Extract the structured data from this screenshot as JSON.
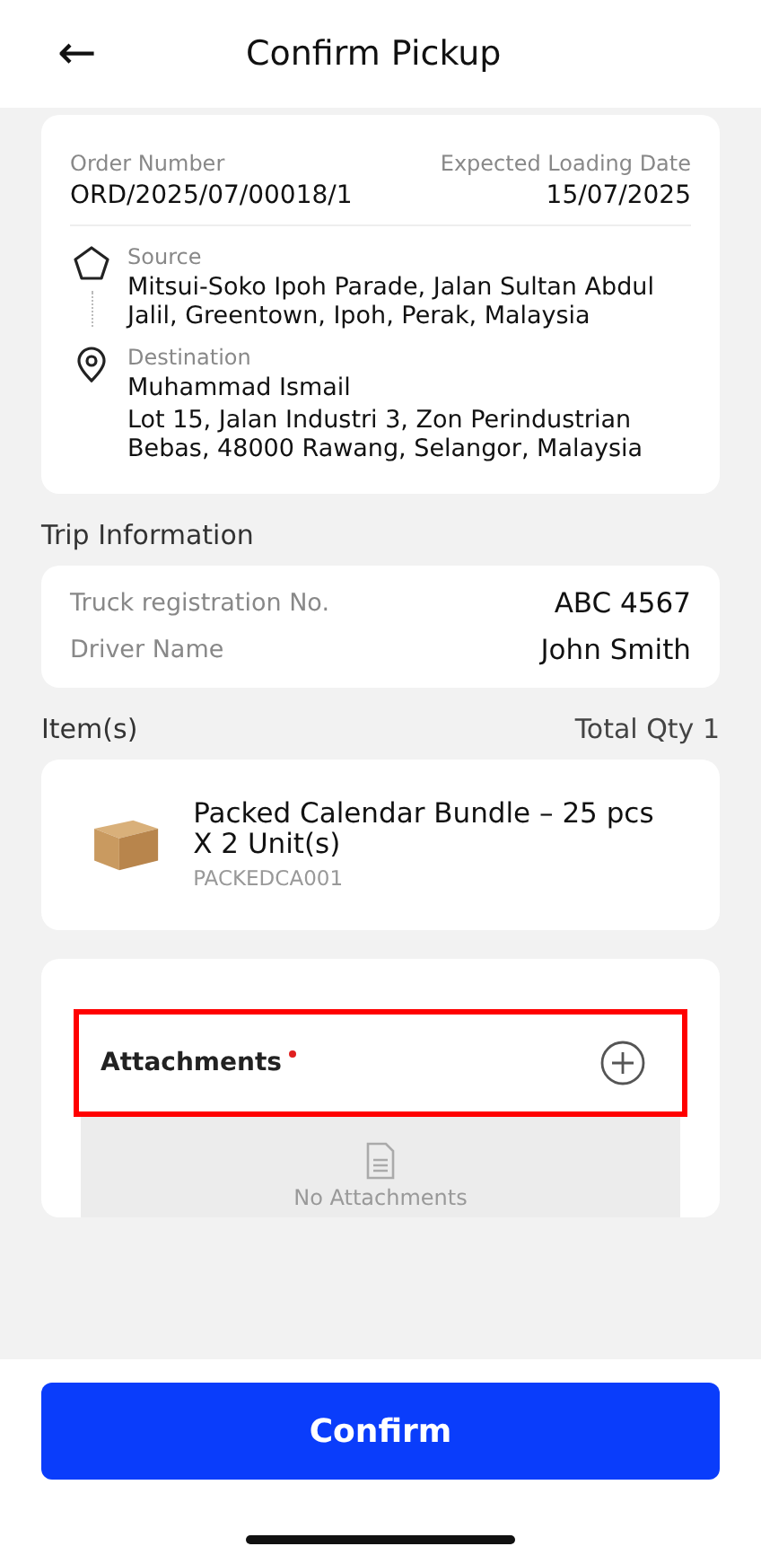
{
  "header": {
    "back": "←",
    "title": "Confirm Pickup"
  },
  "order": {
    "number_label": "Order Number",
    "number": "ORD/2025/07/00018/1",
    "date_label": "Expected Loading Date",
    "date": "15/07/2025",
    "stops": [
      {
        "kind": "source",
        "label": "Source",
        "lines": [
          "Mitsui-Soko  Ipoh Parade, Jalan Sultan Abdul Jalil, Greentown, Ipoh, Perak, Malaysia"
        ]
      },
      {
        "kind": "destination",
        "label": "Destination",
        "lines": [
          "Muhammad Ismail",
          "Lot 15, Jalan Industri 3, Zon Perindustrian Bebas, 48000 Rawang, Selangor, Malaysia"
        ]
      }
    ]
  },
  "trip": {
    "title": "Trip Information",
    "rows": [
      {
        "label": "Truck registration No.",
        "value": "ABC 4567"
      },
      {
        "label": "Driver Name",
        "value": "John Smith"
      }
    ]
  },
  "items": {
    "title": "Item(s)",
    "total": "Total Qty 1",
    "list": [
      {
        "name": "Packed Calendar Bundle – 25 pcs X 2  Unit(s)",
        "code": "PACKEDCA001"
      }
    ]
  },
  "attachments": {
    "label": "Attachments",
    "required": true,
    "empty_text": "No Attachments"
  },
  "confirm_button": "Confirm"
}
